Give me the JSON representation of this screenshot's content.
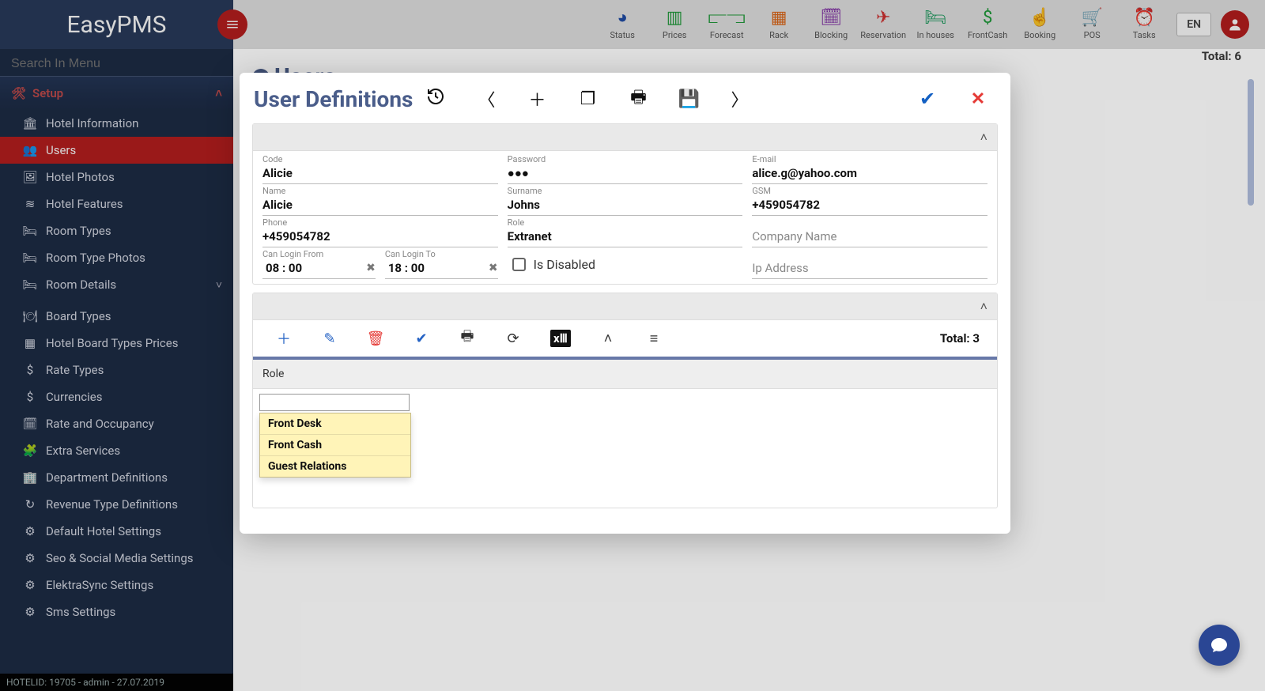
{
  "app": {
    "brand": "EasyPMS"
  },
  "header": {
    "lang": "EN",
    "icons": [
      {
        "name": "status",
        "label": "Status",
        "color": "#1f4da8",
        "glyph": "◕"
      },
      {
        "name": "prices",
        "label": "Prices",
        "color": "#1f9d3a",
        "glyph": "▥"
      },
      {
        "name": "forecast",
        "label": "Forecast",
        "color": "#1f9d3a",
        "glyph": "⫍⫎"
      },
      {
        "name": "rack",
        "label": "Rack",
        "color": "#e06a1a",
        "glyph": "▦"
      },
      {
        "name": "blocking",
        "label": "Blocking",
        "color": "#7a1fa2",
        "glyph": "🗓"
      },
      {
        "name": "reservation",
        "label": "Reservation",
        "color": "#d32f2f",
        "glyph": "✈"
      },
      {
        "name": "inhouses",
        "label": "In houses",
        "color": "#1e9e60",
        "glyph": "🛏"
      },
      {
        "name": "frontcash",
        "label": "FrontCash",
        "color": "#1e9e3a",
        "glyph": "$"
      },
      {
        "name": "booking",
        "label": "Booking",
        "color": "#e06a1a",
        "glyph": "☝"
      },
      {
        "name": "pos",
        "label": "POS",
        "color": "#d32f2f",
        "glyph": "🛒"
      },
      {
        "name": "tasks",
        "label": "Tasks",
        "color": "#e06a1a",
        "glyph": "⏰"
      }
    ]
  },
  "sidebar": {
    "search_placeholder": "Search In Menu",
    "group": "Setup",
    "items": [
      {
        "icon": "🏛",
        "label": "Hotel Information"
      },
      {
        "icon": "👥",
        "label": "Users",
        "active": true
      },
      {
        "icon": "🖼",
        "label": "Hotel Photos"
      },
      {
        "icon": "≋",
        "label": "Hotel Features"
      },
      {
        "icon": "🛏",
        "label": "Room Types"
      },
      {
        "icon": "🛏",
        "label": "Room Type Photos"
      },
      {
        "icon": "🛏",
        "label": "Room Details",
        "expandable": true
      },
      {
        "sep": true
      },
      {
        "icon": "🍽",
        "label": "Board Types"
      },
      {
        "icon": "▦",
        "label": "Hotel Board Types Prices"
      },
      {
        "icon": "$",
        "label": "Rate Types"
      },
      {
        "icon": "$",
        "label": "Currencies"
      },
      {
        "icon": "🗓",
        "label": "Rate and Occupancy"
      },
      {
        "icon": "🧩",
        "label": "Extra Services"
      },
      {
        "icon": "🏢",
        "label": "Department Definitions"
      },
      {
        "icon": "↻",
        "label": "Revenue Type Definitions"
      },
      {
        "icon": "⚙",
        "label": "Default Hotel Settings"
      },
      {
        "icon": "⚙",
        "label": "Seo & Social Media Settings"
      },
      {
        "icon": "⚙",
        "label": "ElektraSync Settings"
      },
      {
        "icon": "⚙",
        "label": "Sms Settings"
      }
    ],
    "footer": "HOTELID: 19705 - admin - 27.07.2019"
  },
  "page": {
    "title": "Users",
    "total_label": "Total: 6"
  },
  "modal": {
    "title": "User Definitions",
    "form": {
      "code": {
        "label": "Code",
        "value": "Alicie"
      },
      "password": {
        "label": "Password",
        "value": "●●●"
      },
      "email": {
        "label": "E-mail",
        "value": "alice.g@yahoo.com"
      },
      "name": {
        "label": "Name",
        "value": "Alicie"
      },
      "surname": {
        "label": "Surname",
        "value": "Johns"
      },
      "gsm": {
        "label": "GSM",
        "value": "+459054782"
      },
      "phone": {
        "label": "Phone",
        "value": "+459054782"
      },
      "role": {
        "label": "Role",
        "value": "Extranet"
      },
      "company": {
        "placeholder": "Company Name"
      },
      "login_from": {
        "label": "Can Login From",
        "value": "08 : 00"
      },
      "login_to": {
        "label": "Can Login To",
        "value": "18 : 00"
      },
      "is_disabled": {
        "label": "Is Disabled"
      },
      "ip": {
        "placeholder": "Ip Address"
      }
    },
    "roles": {
      "header": "Role",
      "total_label": "Total: 3",
      "options": [
        "Front Desk",
        "Front Cash",
        "Guest Relations"
      ]
    }
  }
}
